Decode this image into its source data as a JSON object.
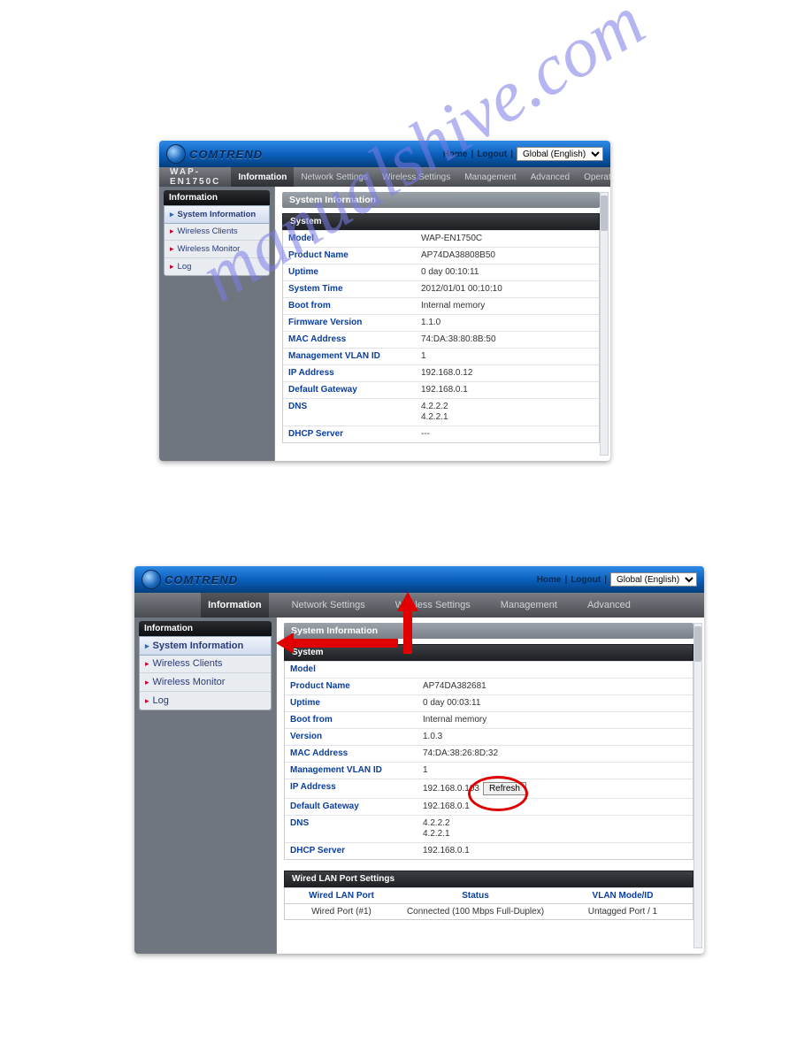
{
  "brand": "COMTREND",
  "top_links": {
    "home": "Home",
    "logout": "Logout"
  },
  "lang": "Global (English)",
  "panel1": {
    "device_model": "WAP-EN1750C",
    "menu": [
      "Information",
      "Network Settings",
      "Wireless Settings",
      "Management",
      "Advanced",
      "Operation Mode"
    ],
    "sidebar_title": "Information",
    "sidebar_items": [
      "System Information",
      "Wireless Clients",
      "Wireless Monitor",
      "Log"
    ],
    "sidebar_active": 0,
    "section_title": "System Information",
    "subhead": "System",
    "rows": [
      {
        "k": "Model",
        "v": "WAP-EN1750C"
      },
      {
        "k": "Product Name",
        "v": "AP74DA38808B50"
      },
      {
        "k": "Uptime",
        "v": "0 day 00:10:11"
      },
      {
        "k": "System Time",
        "v": "2012/01/01 00:10:10"
      },
      {
        "k": "Boot from",
        "v": "Internal memory"
      },
      {
        "k": "Firmware Version",
        "v": "1.1.0"
      },
      {
        "k": "MAC Address",
        "v": "74:DA:38:80:8B:50"
      },
      {
        "k": "Management VLAN ID",
        "v": "1"
      },
      {
        "k": "IP Address",
        "v": "192.168.0.12"
      },
      {
        "k": "Default Gateway",
        "v": "192.168.0.1"
      },
      {
        "k": "DNS",
        "v": "4.2.2.2\n4.2.2.1"
      },
      {
        "k": "DHCP Server",
        "v": "---"
      }
    ]
  },
  "panel2": {
    "menu": [
      "Information",
      "Network Settings",
      "Wireless Settings",
      "Management",
      "Advanced"
    ],
    "sidebar_title": "Information",
    "sidebar_items": [
      "System Information",
      "Wireless Clients",
      "Wireless Monitor",
      "Log"
    ],
    "sidebar_active": 0,
    "section_title": "System Information",
    "subhead": "System",
    "rows": [
      {
        "k": "Model",
        "v": ""
      },
      {
        "k": "Product Name",
        "v": "AP74DA382681"
      },
      {
        "k": "Uptime",
        "v": "0 day 00:03:11"
      },
      {
        "k": "Boot from",
        "v": "Internal memory"
      },
      {
        "k": "Version",
        "v": "1.0.3"
      },
      {
        "k": "MAC Address",
        "v": "74:DA:38:26:8D:32"
      },
      {
        "k": "Management VLAN ID",
        "v": "1"
      },
      {
        "k": "IP Address",
        "v": "192.168.0.103"
      },
      {
        "k": "Default Gateway",
        "v": "192.168.0.1"
      },
      {
        "k": "DNS",
        "v": "4.2.2.2\n4.2.2.1"
      },
      {
        "k": "DHCP Server",
        "v": "192.168.0.1"
      }
    ],
    "refresh_label": "Refresh",
    "lan_title": "Wired LAN Port Settings",
    "lan_headers": [
      "Wired LAN Port",
      "Status",
      "VLAN Mode/ID"
    ],
    "lan_row": [
      "Wired Port (#1)",
      "Connected (100 Mbps Full-Duplex)",
      "Untagged Port  /   1"
    ]
  },
  "watermark_text": "manualshive.com"
}
